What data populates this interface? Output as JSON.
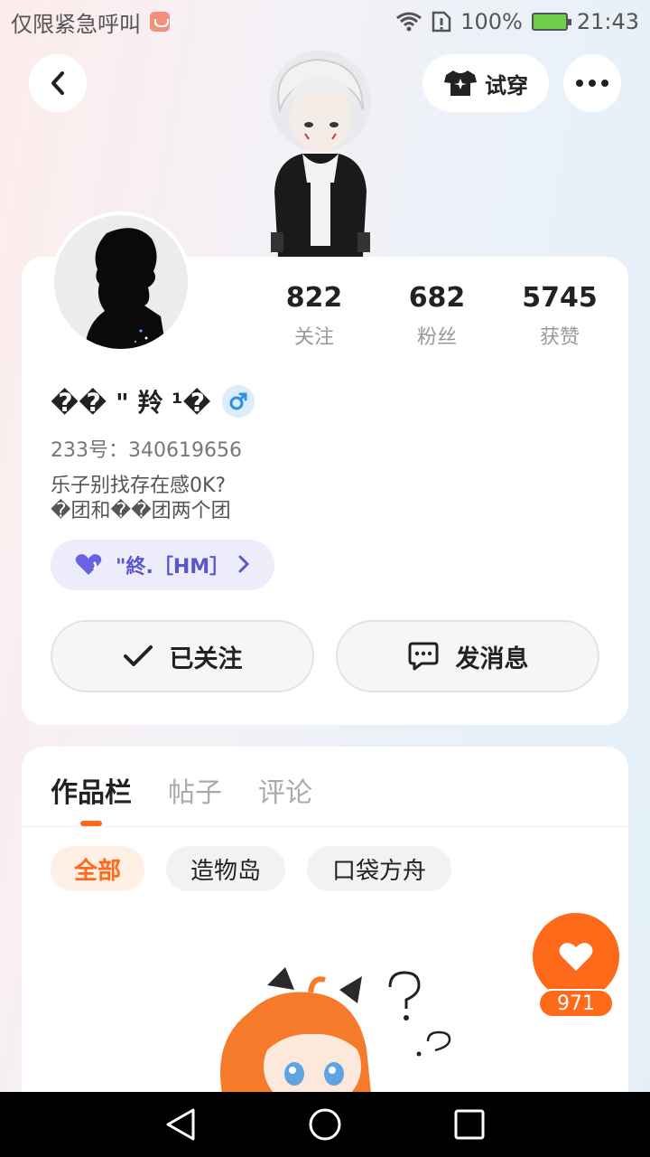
{
  "status_bar": {
    "carrier": "仅限紧急呼叫",
    "battery": "100%",
    "time": "21:43"
  },
  "header": {
    "tryon_label": "试穿"
  },
  "profile": {
    "stats": [
      {
        "value": "822",
        "label": "关注"
      },
      {
        "value": "682",
        "label": "粉丝"
      },
      {
        "value": "5745",
        "label": "获赞"
      }
    ],
    "username": "�� \" 羚 ¹�",
    "user_id": "233号：340619656",
    "bio_line1": "乐子别找存在感0K?",
    "bio_line2": "�团和��团两个团",
    "guild_name": "\"終.［HM］",
    "follow_label": "已关注",
    "message_label": "发消息"
  },
  "tabs": [
    {
      "label": "作品栏"
    },
    {
      "label": "帖子"
    },
    {
      "label": "评论"
    }
  ],
  "filters": [
    {
      "label": "全部"
    },
    {
      "label": "造物岛"
    },
    {
      "label": "口袋方舟"
    }
  ],
  "like_count": "971",
  "colors": {
    "accent": "#ff6a1a",
    "guild": "#5a55c8",
    "gender": "#2f8fe0"
  }
}
